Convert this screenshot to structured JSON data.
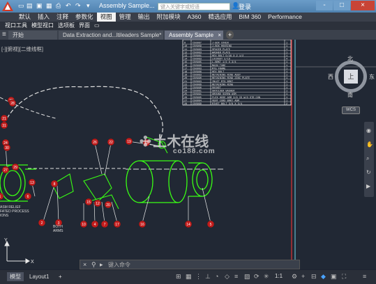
{
  "titlebar": {
    "title": "Assembly Sample...",
    "search_placeholder": "键入关键字或短语",
    "login_label": "登录",
    "window_buttons": [
      "-",
      "□",
      "×"
    ]
  },
  "ribbon": {
    "tabs": [
      "默认",
      "插入",
      "注释",
      "参数化",
      "视图",
      "管理",
      "输出",
      "附加模块",
      "A360",
      "精选应用",
      "BIM 360",
      "Performance"
    ],
    "active_tab": "视图"
  },
  "toolbar_row": {
    "items": [
      "视口工具",
      "模型视口",
      "选项板",
      "界面"
    ]
  },
  "doc_tabs": {
    "tabs": [
      "开始",
      "Data Extraction and...ltileaders Sample*",
      "Assembly Sample"
    ],
    "active": "Assembly Sample",
    "add_label": "+"
  },
  "viewport": {
    "label": "[-][俯视][二维线框]"
  },
  "viewcube": {
    "north": "北",
    "south": "南",
    "east": "东",
    "west": "西",
    "top": "上",
    "wcs": "WCS"
  },
  "bom_table": {
    "rows": [
      [
        "9",
        "CS0997",
        "J-BOX COVER",
        "1"
      ],
      [
        "10",
        "CS0909",
        "J-BOX HOUSING",
        "1"
      ],
      [
        "11",
        "CS0983",
        "SPACER PLATE",
        "1"
      ],
      [
        "12",
        "CS0983",
        "WASHER PLATE",
        "1"
      ],
      [
        "13",
        "CS0981",
        "HEX BOLT 5/16 X 2 1/2",
        "1"
      ],
      [
        "14",
        "CS0983",
        "LOCKNUT 5/16",
        "4"
      ],
      [
        "15",
        "CS0985",
        "L-BRKT 1/2 X 3/4",
        "1"
      ],
      [
        "16",
        "CS0990",
        "MAIN TUBE",
        "1"
      ],
      [
        "17",
        "CS0993",
        "MTG FRAME",
        "1"
      ],
      [
        "18",
        "CS0986",
        "HEX BOLT",
        "1"
      ],
      [
        "19",
        "CS0983",
        "RETAINING RING ASSY",
        "1"
      ],
      [
        "20",
        "CS0990",
        "RETAINING RING ZINC PLATE",
        "1"
      ],
      [
        "21",
        "CS0993",
        "INLET MTG BRKT",
        "1"
      ],
      [
        "22",
        "CS0986",
        "RETAINING RING",
        "1"
      ],
      [
        "23",
        "CS0990",
        "SOCKET",
        "1"
      ],
      [
        "24",
        "CS0991",
        "SHOULDER WASHER",
        "1"
      ],
      [
        "25",
        "CS0991",
        "GROUND SCREW ASM",
        "1"
      ],
      [
        "26",
        "CS0995",
        "FLEX HOSE ASM 3/8 ID W/O STR CON",
        "1"
      ],
      [
        "27",
        "CS0994",
        "VENT CORD BRKT ASM",
        "1"
      ],
      [
        "28",
        "CS0999",
        "RIVET BOLT 3/8 X 3/4",
        "2"
      ]
    ]
  },
  "balloons": [
    "23",
    "21",
    "26",
    "22",
    "19",
    "18",
    "24",
    "28",
    "31",
    "30",
    "29",
    "27",
    "13",
    "8",
    "6",
    "1",
    "2",
    "3",
    "10",
    "4",
    "7",
    "17",
    "16",
    "14",
    "5",
    "12",
    "15",
    "20"
  ],
  "callout_text": "BOTH ARMS",
  "left_note": "ASM RELIEF\nFATED PROCESS\nIONS",
  "watermark": {
    "main": "土木在线",
    "sub": "co188.com"
  },
  "command": {
    "placeholder": "键入命令"
  },
  "status": {
    "layout_tabs": [
      "模型",
      "Layout1"
    ],
    "active_layout": "模型",
    "add_label": "+",
    "scale": "1:1"
  },
  "colors": {
    "title_blue": "#5b8cba",
    "drawing_green": "#39ff14",
    "balloon_red": "#c21b1b",
    "canvas_bg": "#212834"
  }
}
